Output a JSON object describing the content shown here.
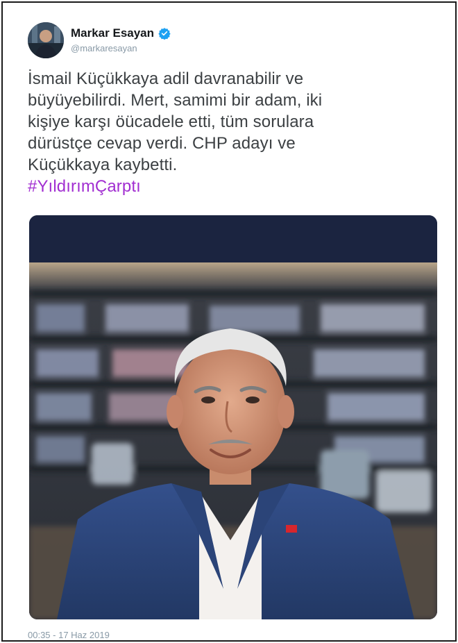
{
  "tweet": {
    "author": {
      "display_name": "Markar Esayan",
      "handle": "@markaresayan",
      "verified": true,
      "verified_color": "#1da1f2"
    },
    "text_lines": [
      "İsmail Küçükkaya adil davranabilir ve",
      "büyüyebilirdi. Mert, samimi bir adam, iki",
      "kişiye karşı öücadele etti, tüm sorulara",
      "dürüstçe cevap verdi. CHP adayı ve",
      "Küçükkaya kaybetti."
    ],
    "hashtag": "#YıldırımÇarptı",
    "hashtag_color": "#a12ed1",
    "timestamp": "00:35 - 17 Haz 2019"
  },
  "colors": {
    "media_bar": "#1b2440",
    "text": "#3c4043",
    "meta": "#8899a6"
  }
}
